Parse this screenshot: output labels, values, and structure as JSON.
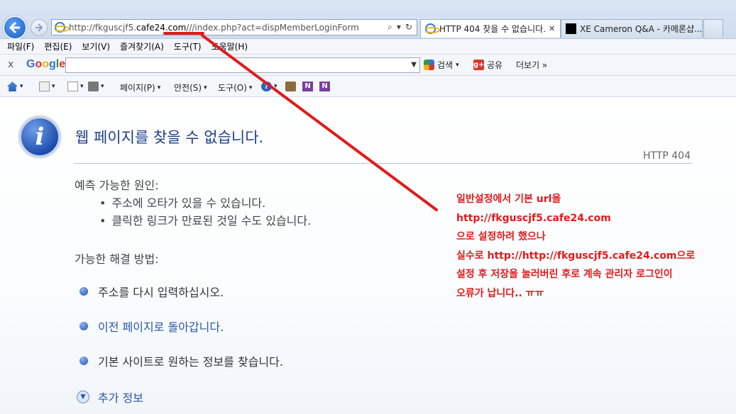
{
  "browser": {
    "url_prefix": "http://fkguscjf5.",
    "url_domain": "cafe24.com",
    "url_rest": "///index.php?act=dispMemberLoginForm",
    "tabs": [
      {
        "label": "HTTP 404 찾을 수 없습니다.",
        "close": "✕"
      },
      {
        "label": "XE Cameron Q&A - 카메론샵..."
      }
    ]
  },
  "menu": [
    "파일(F)",
    "편집(E)",
    "보기(V)",
    "즐겨찾기(A)",
    "도구(T)",
    "도움말(H)"
  ],
  "google_toolbar": {
    "close": "x",
    "logo": [
      "G",
      "o",
      "o",
      "g",
      "l",
      "e"
    ],
    "search_label": "검색",
    "share_label": "공유",
    "more_label": "더보기 »"
  },
  "command_bar": {
    "page": "페이지(P)",
    "safety": "안전(S)",
    "tools": "도구(O)"
  },
  "error_page": {
    "title": "웹 페이지를 찾을 수 없습니다.",
    "code": "HTTP 404",
    "causes_title": "예측 가능한 원인:",
    "causes": [
      "주소에 오타가 있을 수 있습니다.",
      "클릭한 링크가 만료된 것일 수도 있습니다."
    ],
    "solutions_title": "가능한 해결 방법:",
    "solutions": [
      "주소를 다시 입력하십시오.",
      "이전 페이지로 돌아갑니다.",
      "기본 사이트로 원하는 정보를 찾습니다."
    ],
    "more_info": "추가 정보"
  },
  "annotation": {
    "lines": [
      "일반설정에서 기본 url을",
      "http://fkguscjf5.cafe24.com",
      "으로 설정하려 했으나",
      "실수로 http://http://fkguscjf5.cafe24.com으로",
      "설정 후 저장을 눌러버린 후로 계속 관리자 로그인이",
      "오류가 납니다.. ㅠㅠ"
    ],
    "color": "#e11b1b"
  }
}
